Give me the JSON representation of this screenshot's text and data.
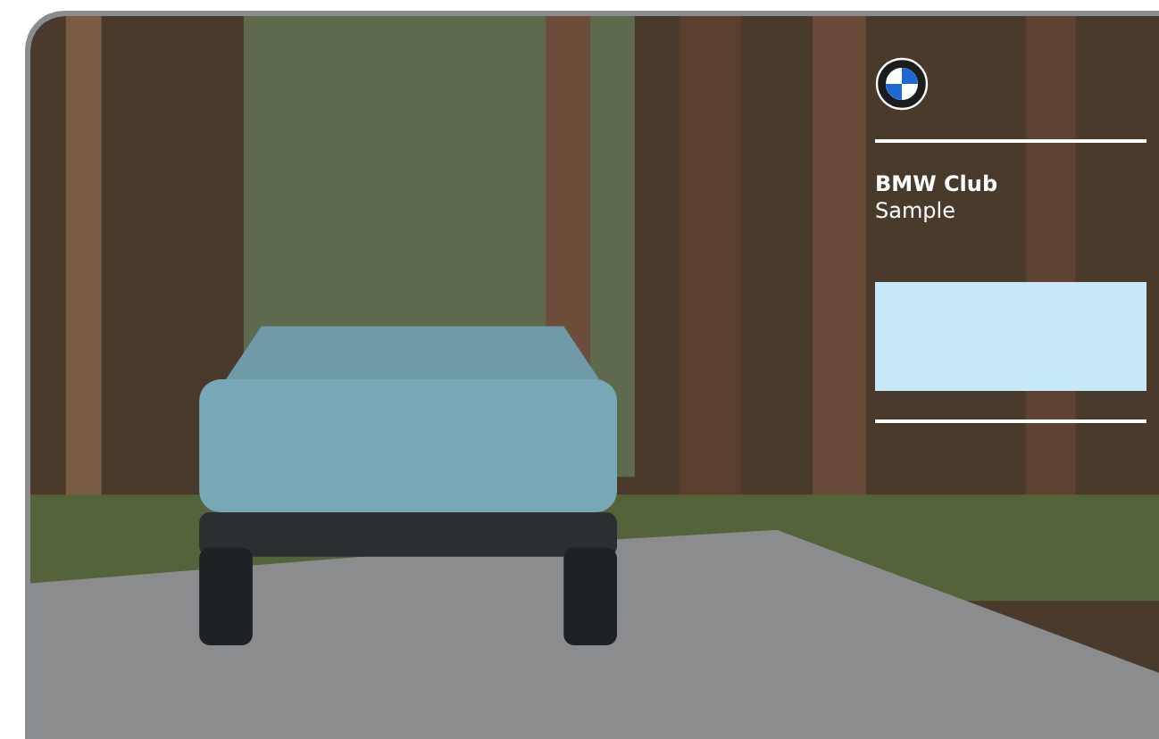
{
  "card": {
    "club_name": "BMW Club",
    "member_name": "Sample",
    "color_panel": {
      "color": "#c6e8f8"
    }
  }
}
